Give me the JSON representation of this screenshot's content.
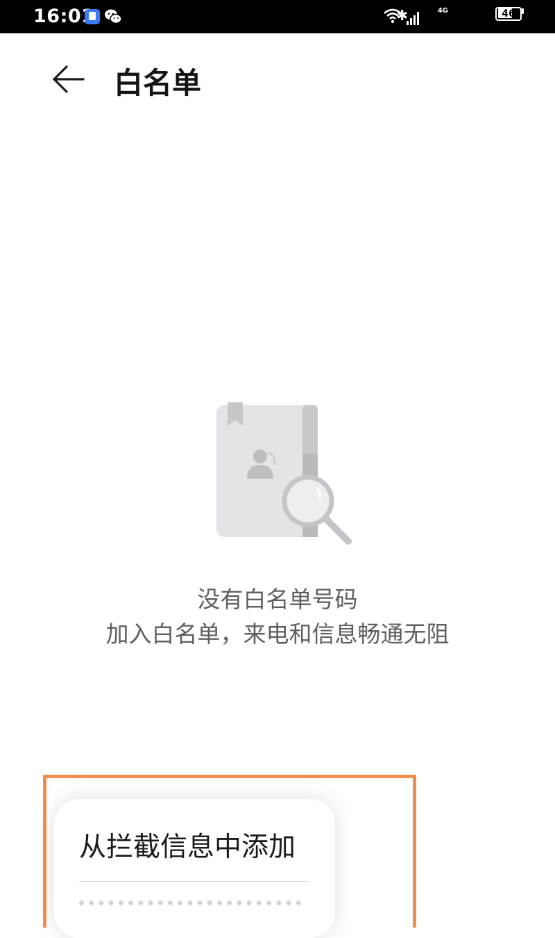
{
  "status_bar": {
    "time": "16:01",
    "network_label": "4G",
    "battery_level": "46",
    "icons": [
      "notification-app-icon",
      "wechat-icon",
      "bluetooth-icon",
      "wifi-icon",
      "cellular-signal-icon",
      "battery-icon"
    ]
  },
  "header": {
    "title": "白名单",
    "back_icon": "back-arrow-icon"
  },
  "empty_state": {
    "icon": "contacts-book-search-icon",
    "title": "没有白名单号码",
    "subtitle": "加入白名单，来电和信息畅通无阻"
  },
  "menu": {
    "items": [
      {
        "label": "从拦截信息中添加"
      }
    ]
  },
  "colors": {
    "highlight": "#ee8f4f",
    "text_primary": "#141414",
    "text_secondary": "#5f5f5f",
    "status_bar": "#000000"
  }
}
